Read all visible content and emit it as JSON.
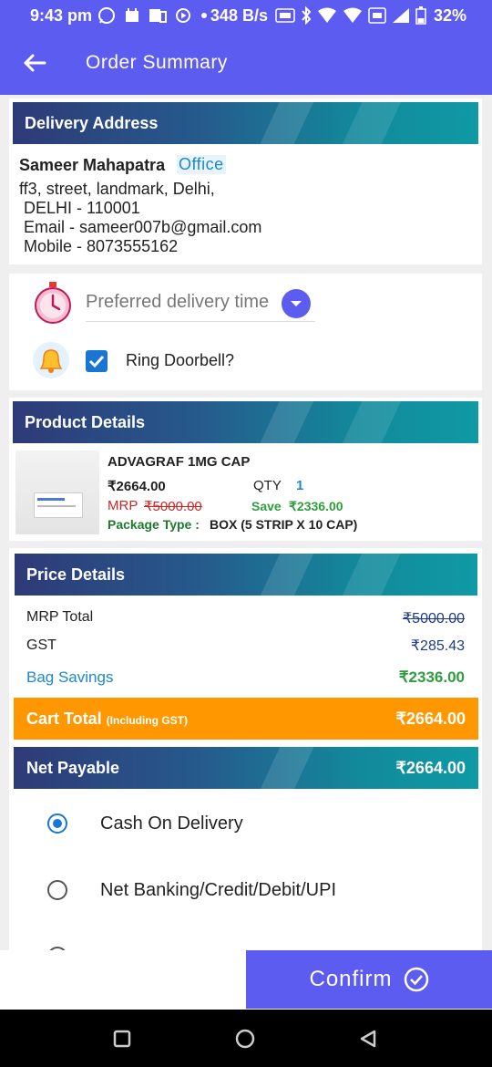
{
  "status_bar": {
    "time": "9:43 pm",
    "speed": "348 B/s",
    "battery": "32%"
  },
  "header": {
    "title": "Order Summary"
  },
  "delivery": {
    "section_title": "Delivery Address",
    "name": "Sameer Mahapatra",
    "tag": "Office",
    "line1": "ff3, street, landmark, Delhi,",
    "line2": "DELHI - 110001",
    "email": "Email - sameer007b@gmail.com",
    "mobile": "Mobile - 8073555162"
  },
  "options": {
    "delivery_time_placeholder": "Preferred delivery time",
    "ring_doorbell_label": "Ring Doorbell?",
    "ring_doorbell_checked": true
  },
  "product": {
    "section_title": "Product Details",
    "name": "ADVAGRAF 1MG CAP",
    "price": "₹2664.00",
    "qty_label": "QTY",
    "qty": "1",
    "mrp_label": "MRP",
    "mrp": "₹5000.00",
    "save_label": "Save",
    "save": "₹2336.00",
    "package_label": "Package Type :",
    "package": "BOX (5 STRIP X 10 CAP)"
  },
  "price_details": {
    "section_title": "Price Details",
    "mrp_total_label": "MRP Total",
    "mrp_total": "₹5000.00",
    "gst_label": "GST",
    "gst": "₹285.43",
    "bag_savings_label": "Bag Savings",
    "bag_savings": "₹2336.00",
    "cart_total_label": "Cart Total",
    "cart_total_note": "(Including GST)",
    "cart_total": "₹2664.00",
    "net_payable_label": "Net Payable",
    "net_payable": "₹2664.00"
  },
  "payment": {
    "options": [
      "Cash On Delivery",
      "Net Banking/Credit/Debit/UPI"
    ],
    "selected": "Cash On Delivery"
  },
  "footer": {
    "confirm_label": "Confirm"
  },
  "colors": {
    "primary": "#5d5cf0",
    "orange": "#ff9800",
    "green": "#2e9e3e",
    "red": "#c62828",
    "blue": "#1e88c8"
  }
}
